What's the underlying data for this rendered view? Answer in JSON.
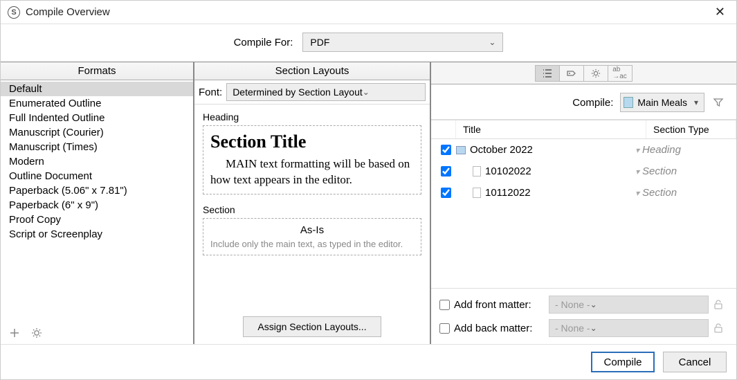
{
  "window": {
    "title": "Compile Overview"
  },
  "compileFor": {
    "label": "Compile For:",
    "value": "PDF"
  },
  "formats": {
    "header": "Formats",
    "items": [
      "Default",
      "Enumerated Outline",
      "Full Indented Outline",
      "Manuscript (Courier)",
      "Manuscript (Times)",
      "Modern",
      "Outline Document",
      "Paperback (5.06\" x 7.81\")",
      "Paperback (6\" x 9\")",
      "Proof Copy",
      "Script or Screenplay"
    ],
    "selectedIndex": 0
  },
  "layouts": {
    "header": "Section Layouts",
    "fontLabel": "Font:",
    "fontValue": "Determined by Section Layout",
    "headingLabel": "Heading",
    "previewTitle": "Section Title",
    "previewBody": "MAIN text formatting will be based on how text appears in the editor.",
    "sectionLabel": "Section",
    "asIsTitle": "As-Is",
    "asIsDesc": "Include only the main text, as typed in the editor.",
    "assignButton": "Assign Section Layouts..."
  },
  "right": {
    "compileLabel": "Compile:",
    "compileTarget": "Main Meals",
    "columns": {
      "title": "Title",
      "sectionType": "Section Type"
    },
    "rows": [
      {
        "checked": true,
        "icon": "folder",
        "indent": 0,
        "title": "October 2022",
        "type": "Heading"
      },
      {
        "checked": true,
        "icon": "page",
        "indent": 1,
        "title": "10102022",
        "type": "Section"
      },
      {
        "checked": true,
        "icon": "page",
        "indent": 1,
        "title": "10112022",
        "type": "Section"
      }
    ],
    "frontMatter": {
      "label": "Add front matter:",
      "value": "- None -"
    },
    "backMatter": {
      "label": "Add back matter:",
      "value": "- None -"
    }
  },
  "buttons": {
    "compile": "Compile",
    "cancel": "Cancel"
  }
}
